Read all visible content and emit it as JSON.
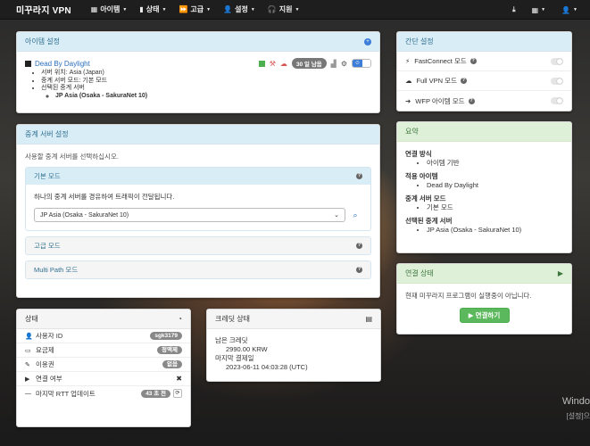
{
  "navbar": {
    "brand": "미꾸라지 VPN",
    "menu": [
      {
        "icon": "grid-icon",
        "glyph": "▦",
        "label": "아이템"
      },
      {
        "icon": "bar-chart-icon",
        "glyph": "▮",
        "label": "상태"
      },
      {
        "icon": "fast-forward-icon",
        "glyph": "⏩",
        "label": "고급"
      },
      {
        "icon": "person-icon",
        "glyph": "👤",
        "label": "설정"
      },
      {
        "icon": "headset-icon",
        "glyph": "🎧",
        "label": "지원"
      }
    ]
  },
  "item_settings": {
    "title": "아이템 설정",
    "game": {
      "name": "Dead By Daylight",
      "days_badge": "30 일 남음",
      "details": [
        "서버 위치: Asia (Japan)",
        "중계 서버 모드: 기본 모드",
        "선택된 중계 서버"
      ],
      "relay": "JP Asia (Osaka - SakuraNet 10)"
    }
  },
  "relay_settings": {
    "title": "중계 서버 설정",
    "description": "사용할 중계 서버를 선택하십시오.",
    "basic_mode": {
      "title": "기본 모드",
      "description": "하나의 중계 서버를 경유하여 트래픽이 전달됩니다.",
      "selected": "JP Asia (Osaka - SakuraNet 10)"
    },
    "advanced_mode": "고급 모드",
    "multipath_mode": "Multi Path 모드"
  },
  "quick_settings": {
    "title": "간단 설정",
    "items": [
      {
        "label": "FastConnect 모드",
        "icon": "bolt-icon"
      },
      {
        "label": "Full VPN 모드",
        "icon": "cloud-icon"
      },
      {
        "label": "WFP 아이템 모드",
        "icon": "arrow-right-icon"
      }
    ]
  },
  "summary": {
    "title": "요약",
    "sections": [
      {
        "heading": "연결 방식",
        "value": "아이템 기반"
      },
      {
        "heading": "적용 아이템",
        "value": "Dead By Daylight"
      },
      {
        "heading": "중계 서버 모드",
        "value": "기본 모드"
      },
      {
        "heading": "선택된 중계 서버",
        "value": "JP Asia (Osaka - SakuraNet 10)"
      }
    ]
  },
  "connection": {
    "title": "연결 상태",
    "message": "현재 미꾸라지 프로그램이 실행중이 아닙니다.",
    "connect_label": "연결하기"
  },
  "status": {
    "title": "상태",
    "rows": [
      {
        "label": "사용자 ID",
        "value": "sgk3179"
      },
      {
        "label": "요금제",
        "value": "정액제"
      },
      {
        "label": "이용권",
        "value": "없음"
      },
      {
        "label": "연결 여부",
        "value": "✖"
      },
      {
        "label": "마지막 RTT 업데이트",
        "value": "43 초 전"
      }
    ]
  },
  "credit": {
    "title": "크레딧 상태",
    "remaining_label": "남은 크레딧",
    "remaining_value": "2990.00 KRW",
    "last_payment_label": "마지막 결제일",
    "last_payment_value": "2023-06-11 04:03:28 (UTC)"
  },
  "os_watermark": {
    "line1": "Windo",
    "line2": "[설정]으"
  }
}
